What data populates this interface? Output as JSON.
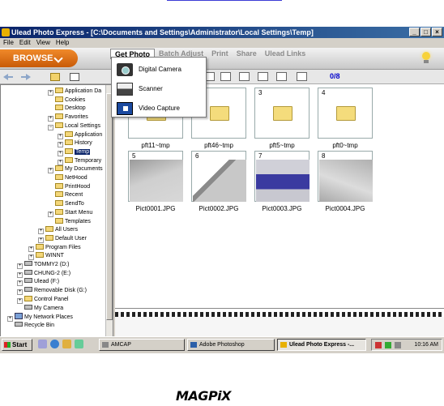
{
  "window": {
    "title": "Ulead Photo Express - [C:\\Documents and Settings\\Administrator\\Local Settings\\Temp]",
    "controls": [
      "_",
      "□",
      "×"
    ]
  },
  "menu": [
    "File",
    "Edit",
    "View",
    "Help"
  ],
  "browse_label": "BROWSE",
  "mode_tabs": [
    "Get Photo",
    "Batch Adjust",
    "Print",
    "Share",
    "Ulead Links"
  ],
  "dropdown": [
    {
      "label": "Digital Camera",
      "icon": "camera-icon"
    },
    {
      "label": "Scanner",
      "icon": "scanner-icon"
    },
    {
      "label": "Video Capture",
      "icon": "video-capture-icon"
    }
  ],
  "nav": {
    "count": "0/8"
  },
  "tree": [
    {
      "label": "Application Da",
      "exp": "+",
      "type": "folder"
    },
    {
      "label": "Cookies",
      "exp": "",
      "type": "folder"
    },
    {
      "label": "Desktop",
      "exp": "",
      "type": "folder"
    },
    {
      "label": "Favorites",
      "exp": "+",
      "type": "folder"
    },
    {
      "label": "Local Settings",
      "exp": "−",
      "type": "folder"
    },
    {
      "label": "Application",
      "exp": "+",
      "type": "folder"
    },
    {
      "label": "History",
      "exp": "+",
      "type": "folder"
    },
    {
      "label": "Temp",
      "exp": "+",
      "type": "folder",
      "selected": true
    },
    {
      "label": "Temporary",
      "exp": "+",
      "type": "folder"
    },
    {
      "label": "My Documents",
      "exp": "+",
      "type": "folder"
    },
    {
      "label": "NetHood",
      "exp": "",
      "type": "folder"
    },
    {
      "label": "PrintHood",
      "exp": "",
      "type": "folder"
    },
    {
      "label": "Recent",
      "exp": "",
      "type": "folder"
    },
    {
      "label": "SendTo",
      "exp": "",
      "type": "folder"
    },
    {
      "label": "Start Menu",
      "exp": "+",
      "type": "folder"
    },
    {
      "label": "Templates",
      "exp": "",
      "type": "folder"
    },
    {
      "label": "All Users",
      "exp": "+",
      "type": "folder"
    },
    {
      "label": "Default User",
      "exp": "+",
      "type": "folder"
    },
    {
      "label": "Program Files",
      "exp": "+",
      "type": "folder"
    },
    {
      "label": "WINNT",
      "exp": "+",
      "type": "folder"
    },
    {
      "label": "TOMMY2 (D:)",
      "exp": "+",
      "type": "drive"
    },
    {
      "label": "CHUNG-2 (E:)",
      "exp": "+",
      "type": "drive"
    },
    {
      "label": "Ulead (F:)",
      "exp": "+",
      "type": "drive"
    },
    {
      "label": "Removable Disk (G:)",
      "exp": "+",
      "type": "drive"
    },
    {
      "label": "Control Panel",
      "exp": "+",
      "type": "folder"
    },
    {
      "label": "My Camera",
      "exp": "",
      "type": "drive"
    },
    {
      "label": "My Network Places",
      "exp": "+",
      "type": "net"
    },
    {
      "label": "Recycle Bin",
      "exp": "",
      "type": "drive"
    }
  ],
  "thumbnails": [
    {
      "num": "1",
      "caption": "pft11~tmp",
      "kind": "folder"
    },
    {
      "num": "2",
      "caption": "pft46~tmp",
      "kind": "folder"
    },
    {
      "num": "3",
      "caption": "pft5~tmp",
      "kind": "folder"
    },
    {
      "num": "4",
      "caption": "pft0~tmp",
      "kind": "folder"
    },
    {
      "num": "5",
      "caption": "Pict0001.JPG",
      "kind": "photo"
    },
    {
      "num": "6",
      "caption": "Pict0002.JPG",
      "kind": "photo"
    },
    {
      "num": "7",
      "caption": "Pict0003.JPG",
      "kind": "photo"
    },
    {
      "num": "8",
      "caption": "Pict0004.JPG",
      "kind": "photo"
    }
  ],
  "taskbar": {
    "start": "Start",
    "tasks": [
      {
        "label": "AMCAP",
        "active": false
      },
      {
        "label": "Adobe Photoshop",
        "active": false
      },
      {
        "label": "Ulead Photo Express -...",
        "active": true
      }
    ],
    "clock": "10:16 AM"
  },
  "logo": "MAGPiX"
}
